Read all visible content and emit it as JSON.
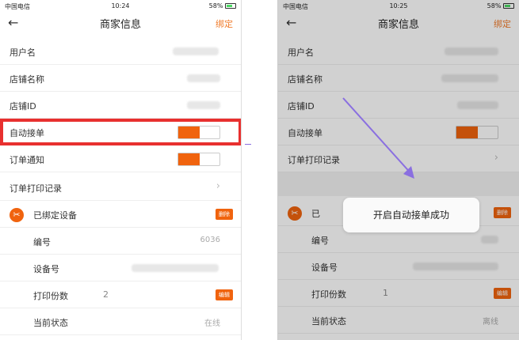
{
  "status_left": {
    "carrier": "中国电信",
    "time": "10:24",
    "battery": "58%"
  },
  "status_right": {
    "carrier": "中国电信",
    "time": "10:25",
    "battery": "58%"
  },
  "nav": {
    "back": "←",
    "title": "商家信息",
    "bind": "绑定"
  },
  "rows": {
    "username": "用户名",
    "shop_name": "店铺名称",
    "shop_id": "店铺ID",
    "auto_accept": "自动接单",
    "order_notify": "订单通知",
    "print_log": "订单打印记录",
    "bound_device": "已绑定设备",
    "bound_device_short": "已",
    "number": "编号",
    "device_no": "设备号",
    "print_copies": "打印份数",
    "state": "当前状态"
  },
  "values_left": {
    "number": "6036",
    "copies": "2",
    "state": "在线",
    "delete": "删除",
    "edit": "编辑"
  },
  "values_right": {
    "copies": "1",
    "state": "离线",
    "delete": "删除",
    "edit": "编辑"
  },
  "toast": "开启自动接单成功",
  "toggles": {
    "left_auto_accept": 0.5,
    "left_order_notify": 0.5,
    "right_auto_accept": 0.5
  },
  "colors": {
    "accent": "#f0630e",
    "highlight": "#e8302f",
    "arrow": "#8a6fe0"
  }
}
